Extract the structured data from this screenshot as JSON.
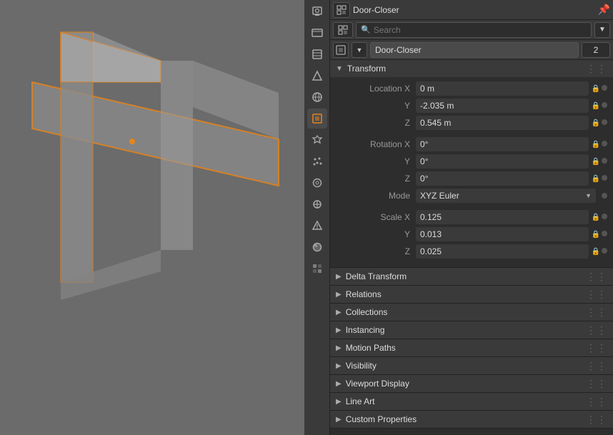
{
  "viewport": {
    "background": "#6b6b6b"
  },
  "header": {
    "panel_dropdown_icon": "▼",
    "title": "Door-Closer",
    "pin_icon": "📌"
  },
  "search": {
    "placeholder": "Search",
    "dropdown_icon": "▼",
    "end_icon": "▼"
  },
  "object_bar": {
    "type_icon": "▢",
    "name": "Door-Closer",
    "number": "2"
  },
  "sections": {
    "transform": {
      "label": "Transform",
      "expanded": true,
      "location": {
        "x": "0 m",
        "y": "-2.035 m",
        "z": "0.545 m"
      },
      "rotation": {
        "x": "0°",
        "y": "0°",
        "z": "0°"
      },
      "mode": {
        "label": "Mode",
        "value": "XYZ Euler"
      },
      "scale": {
        "x": "0.125",
        "y": "0.013",
        "z": "0.025"
      }
    },
    "delta_transform": {
      "label": "Delta Transform",
      "expanded": false
    },
    "relations": {
      "label": "Relations",
      "expanded": false
    },
    "collections": {
      "label": "Collections",
      "expanded": false
    },
    "instancing": {
      "label": "Instancing",
      "expanded": false
    },
    "motion_paths": {
      "label": "Motion Paths",
      "expanded": false
    },
    "visibility": {
      "label": "Visibility",
      "expanded": false
    },
    "viewport_display": {
      "label": "Viewport Display",
      "expanded": false
    },
    "line_art": {
      "label": "Line Art",
      "expanded": false
    },
    "custom_properties": {
      "label": "Custom Properties",
      "expanded": false
    }
  },
  "sidebar_icons": [
    {
      "name": "render-icon",
      "symbol": "📷",
      "active": false
    },
    {
      "name": "output-icon",
      "symbol": "🖨",
      "active": false
    },
    {
      "name": "view-layer-icon",
      "symbol": "📄",
      "active": false
    },
    {
      "name": "scene-icon",
      "symbol": "🎬",
      "active": false
    },
    {
      "name": "world-icon",
      "symbol": "🌍",
      "active": false
    },
    {
      "name": "object-icon",
      "symbol": "⬜",
      "active": true
    },
    {
      "name": "modifier-icon",
      "symbol": "🔧",
      "active": false
    },
    {
      "name": "particles-icon",
      "symbol": "✦",
      "active": false
    },
    {
      "name": "physics-icon",
      "symbol": "〇",
      "active": false
    },
    {
      "name": "constraints-icon",
      "symbol": "🔗",
      "active": false
    },
    {
      "name": "data-icon",
      "symbol": "△",
      "active": false
    },
    {
      "name": "material-icon",
      "symbol": "●",
      "active": false
    },
    {
      "name": "texture-icon",
      "symbol": "☷",
      "active": false
    }
  ],
  "labels": {
    "location_x": "Location X",
    "location_y": "Y",
    "location_z": "Z",
    "rotation_x": "Rotation X",
    "rotation_y": "Y",
    "rotation_z": "Z",
    "scale_x": "Scale X",
    "scale_y": "Y",
    "scale_z": "Z"
  }
}
